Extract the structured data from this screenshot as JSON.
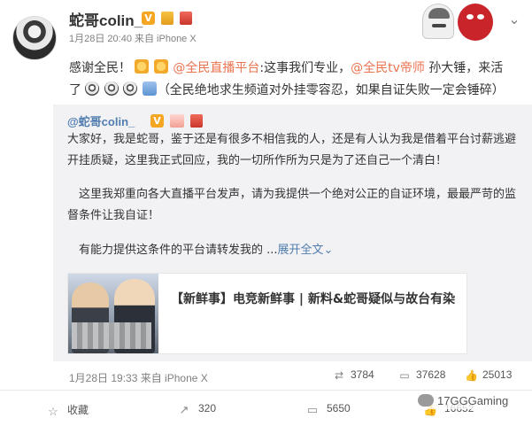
{
  "author": {
    "name": "蛇哥colin_",
    "verified_badge": "V",
    "meta": "1月28日 20:40 来自 iPhone X"
  },
  "post": {
    "line1_start": "感谢全民！",
    "line1_mention1": "@全民直播平台",
    "line1_text2": ":这事我们专业，",
    "line1_mention2": "@全民tv帝师",
    "line1_text3": " 孙大锤，来活",
    "line2_start": "了",
    "line2_text": "（全民绝地求生频道对外挂零容忍，如果自证失败一定会锤碎）"
  },
  "retweet": {
    "user": "@蛇哥colin_",
    "para1": "大家好，我是蛇哥，鉴于还是有很多不相信我的人，还是有人认为我是借着平台讨薪逃避开挂质疑，这里我正式回应，我的一切所作所为只是为了还自己一个清白！",
    "para2": "这里我郑重向各大直播平台发声，请为我提供一个绝对公正的自证环境，最最严苛的监督条件让我自证！",
    "para3_text": "有能力提供这条件的平台请转发我的 ...",
    "para3_more": "展开全文",
    "para3_more_arrow": "⌄",
    "card_title": "【新鲜事】电竞新鲜事 | 新料&蛇哥疑似与故台有染",
    "footer": "1月28日 19:33 来自 iPhone X",
    "stats": {
      "repost": "3784",
      "comment": "37628",
      "like": "25013"
    }
  },
  "actions": {
    "favorite": "收藏",
    "repost": "320",
    "comment": "5650",
    "like": "16652"
  },
  "watermark": "17GGGaming",
  "icons": {
    "more": "chevron-down-icon",
    "repost": "repost-icon",
    "comment": "comment-icon",
    "like": "thumbs-up-icon",
    "favorite": "star-icon"
  },
  "colors": {
    "mention": "#eb7350",
    "link": "#507daf",
    "verified": "#f5a623"
  }
}
